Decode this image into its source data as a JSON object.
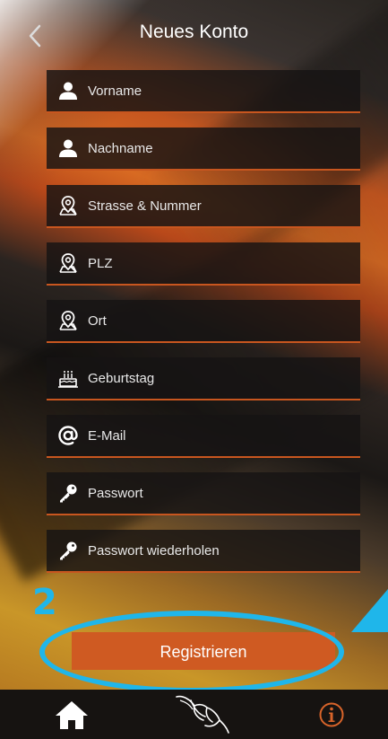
{
  "header": {
    "title": "Neues Konto",
    "back_icon": "chevron-left-icon"
  },
  "form": {
    "fields": [
      {
        "placeholder": "Vorname",
        "icon": "person-icon"
      },
      {
        "placeholder": "Nachname",
        "icon": "person-icon"
      },
      {
        "placeholder": "Strasse & Nummer",
        "icon": "location-pin-icon"
      },
      {
        "placeholder": "PLZ",
        "icon": "location-pin-icon"
      },
      {
        "placeholder": "Ort",
        "icon": "location-pin-icon"
      },
      {
        "placeholder": "Geburtstag",
        "icon": "birthday-cake-icon"
      },
      {
        "placeholder": "E-Mail",
        "icon": "at-sign-icon"
      },
      {
        "placeholder": "Passwort",
        "icon": "key-icon"
      },
      {
        "placeholder": "Passwort wiederholen",
        "icon": "key-icon"
      }
    ],
    "submit_label": "Registrieren"
  },
  "annotation": {
    "step_number": "2",
    "color": "#1fb6ea"
  },
  "tabbar": {
    "items": [
      {
        "icon": "home-icon"
      },
      {
        "icon": "hand-logo-icon"
      },
      {
        "icon": "info-icon"
      }
    ]
  },
  "colors": {
    "accent": "#cf5a22",
    "field_bg": "#161413",
    "tabbar_bg": "#161311"
  }
}
